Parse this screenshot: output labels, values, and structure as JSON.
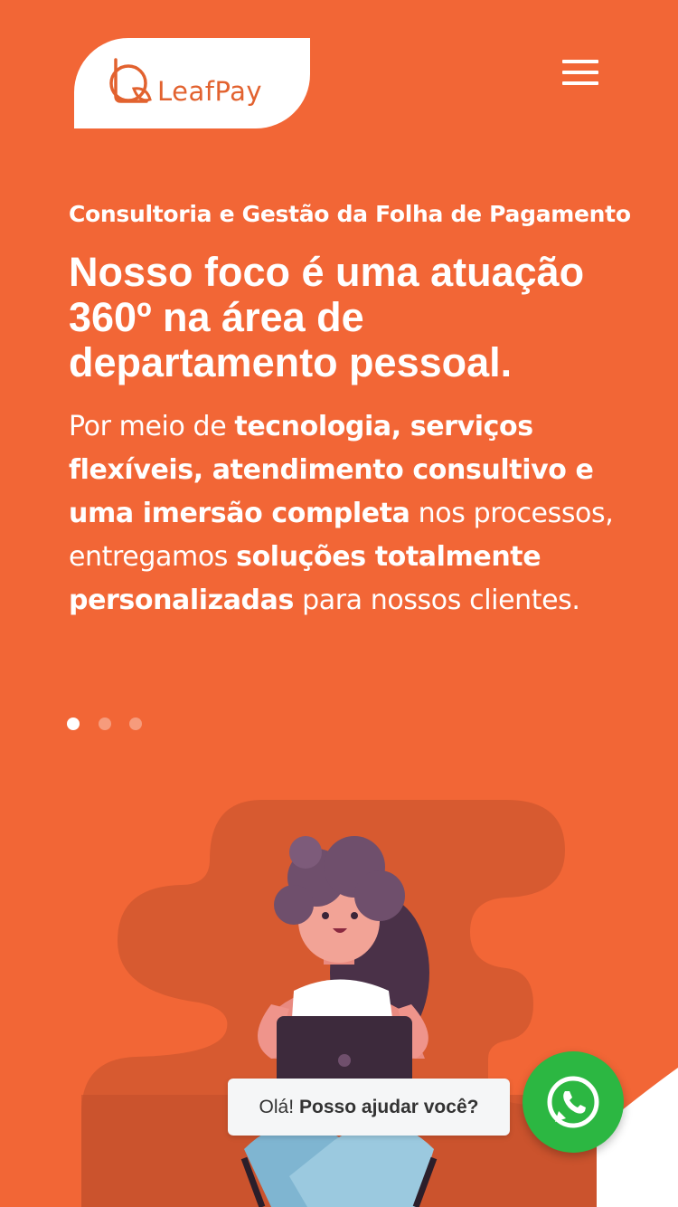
{
  "header": {
    "logo_text": "LeafPay",
    "menu_icon": "hamburger-menu-icon"
  },
  "hero": {
    "subtitle": "Consultoria e Gestão da Folha de Pagamento",
    "headline": "Nosso foco é uma atuação 360º na área de departamento pessoal.",
    "body": {
      "p1": "Por meio de ",
      "b1": "tecnologia, serviços flexíveis, atendimento consultivo e uma imersão completa",
      "p2": " nos processos, entregamos ",
      "b2": "soluções totalmente personalizadas",
      "p3": " para nossos clientes."
    }
  },
  "carousel": {
    "slides": 3,
    "active_index": 0
  },
  "chat": {
    "greeting": "Olá!",
    "prompt": "Posso ajudar você?",
    "icon": "whatsapp-icon",
    "button_color": "#2cb742"
  },
  "colors": {
    "brand_orange": "#f26636",
    "white": "#ffffff"
  }
}
